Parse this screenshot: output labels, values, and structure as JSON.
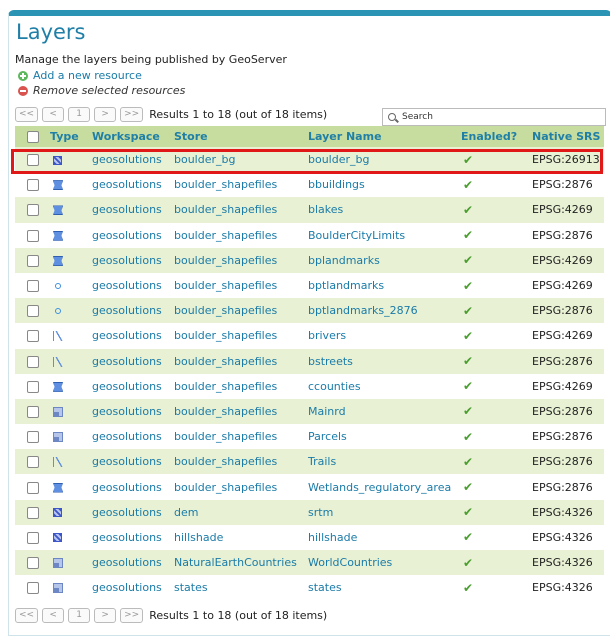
{
  "page": {
    "title": "Layers",
    "description": "Manage the layers being published by GeoServer",
    "add_label": "Add a new resource",
    "remove_label": "Remove selected resources"
  },
  "pager": {
    "first": "<<",
    "prev": "<",
    "page": "1",
    "next": ">",
    "last": ">>",
    "info": "Results 1 to 18 (out of 18 items)"
  },
  "search": {
    "placeholder": "Search"
  },
  "columns": {
    "type": "Type",
    "workspace": "Workspace",
    "store": "Store",
    "layer_name": "Layer Name",
    "enabled": "Enabled?",
    "srs": "Native SRS"
  },
  "enabled_mark": "✔",
  "rows": [
    {
      "type": "raster",
      "workspace": "geosolutions",
      "store": "boulder_bg",
      "name": "boulder_bg",
      "srs": "EPSG:26913"
    },
    {
      "type": "polygon",
      "workspace": "geosolutions",
      "store": "boulder_shapefiles",
      "name": "bbuildings",
      "srs": "EPSG:2876"
    },
    {
      "type": "polygon",
      "workspace": "geosolutions",
      "store": "boulder_shapefiles",
      "name": "blakes",
      "srs": "EPSG:4269"
    },
    {
      "type": "polygon",
      "workspace": "geosolutions",
      "store": "boulder_shapefiles",
      "name": "BoulderCityLimits",
      "srs": "EPSG:2876"
    },
    {
      "type": "polygon",
      "workspace": "geosolutions",
      "store": "boulder_shapefiles",
      "name": "bplandmarks",
      "srs": "EPSG:4269"
    },
    {
      "type": "point",
      "workspace": "geosolutions",
      "store": "boulder_shapefiles",
      "name": "bptlandmarks",
      "srs": "EPSG:4269"
    },
    {
      "type": "point",
      "workspace": "geosolutions",
      "store": "boulder_shapefiles",
      "name": "bptlandmarks_2876",
      "srs": "EPSG:2876"
    },
    {
      "type": "line",
      "workspace": "geosolutions",
      "store": "boulder_shapefiles",
      "name": "brivers",
      "srs": "EPSG:4269"
    },
    {
      "type": "line",
      "workspace": "geosolutions",
      "store": "boulder_shapefiles",
      "name": "bstreets",
      "srs": "EPSG:2876"
    },
    {
      "type": "polygon",
      "workspace": "geosolutions",
      "store": "boulder_shapefiles",
      "name": "ccounties",
      "srs": "EPSG:4269"
    },
    {
      "type": "mixed",
      "workspace": "geosolutions",
      "store": "boulder_shapefiles",
      "name": "Mainrd",
      "srs": "EPSG:2876"
    },
    {
      "type": "mixed",
      "workspace": "geosolutions",
      "store": "boulder_shapefiles",
      "name": "Parcels",
      "srs": "EPSG:2876"
    },
    {
      "type": "line",
      "workspace": "geosolutions",
      "store": "boulder_shapefiles",
      "name": "Trails",
      "srs": "EPSG:2876"
    },
    {
      "type": "polygon",
      "workspace": "geosolutions",
      "store": "boulder_shapefiles",
      "name": "Wetlands_regulatory_area",
      "srs": "EPSG:2876"
    },
    {
      "type": "raster",
      "workspace": "geosolutions",
      "store": "dem",
      "name": "srtm",
      "srs": "EPSG:4326"
    },
    {
      "type": "raster",
      "workspace": "geosolutions",
      "store": "hillshade",
      "name": "hillshade",
      "srs": "EPSG:4326"
    },
    {
      "type": "mixed",
      "workspace": "geosolutions",
      "store": "NaturalEarthCountries",
      "name": "WorldCountries",
      "srs": "EPSG:4326"
    },
    {
      "type": "mixed",
      "workspace": "geosolutions",
      "store": "states",
      "name": "states",
      "srs": "EPSG:4326"
    }
  ]
}
